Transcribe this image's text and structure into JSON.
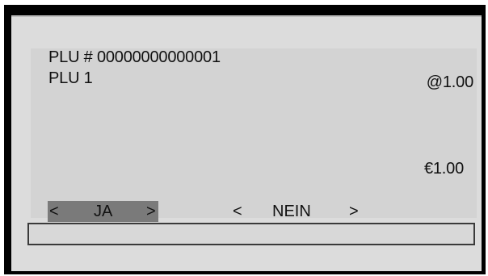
{
  "display": {
    "plu_number_line": "PLU # 00000000000001",
    "plu_name": "PLU 1",
    "unit_price": "@1.00",
    "total_price": "€1.00"
  },
  "buttons": {
    "yes": {
      "prefix": "<",
      "label": "JA",
      "suffix": ">",
      "selected": true
    },
    "no": {
      "prefix": "<",
      "label": "NEIN",
      "suffix": ">",
      "selected": false
    }
  },
  "input": {
    "value": ""
  },
  "colors": {
    "frame": "#000000",
    "background": "#dcdcdc",
    "panel": "#d3d3d3",
    "selected_button": "#7a7a7a",
    "text": "#111111"
  }
}
